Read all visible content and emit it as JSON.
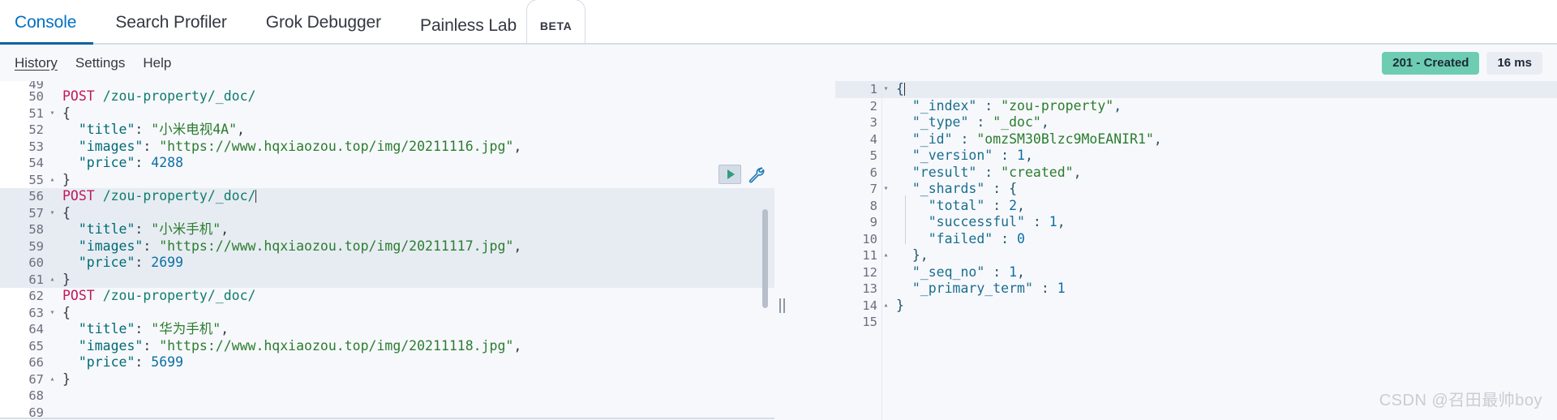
{
  "app": {
    "top_tabs": [
      {
        "label": "Console",
        "active": true,
        "badge": null
      },
      {
        "label": "Search Profiler",
        "active": false,
        "badge": null
      },
      {
        "label": "Grok Debugger",
        "active": false,
        "badge": null
      },
      {
        "label": "Painless Lab",
        "active": false,
        "badge": "BETA"
      }
    ],
    "sub_links": [
      {
        "label": "History",
        "underlined": true
      },
      {
        "label": "Settings",
        "underlined": false
      },
      {
        "label": "Help",
        "underlined": false
      }
    ],
    "status": {
      "response_code": "201 - Created",
      "response_code_color": "#6dccb1",
      "elapsed": "16 ms",
      "elapsed_color": "#e9edf3"
    },
    "accent_color": "#0071c2",
    "active_tab_underline_color": "#0b64a0",
    "watermark": "CSDN @召田最帅boy"
  },
  "request_editor": {
    "name": "console-request-editor",
    "active_line": 56,
    "lines": [
      {
        "n": "49",
        "fold": "",
        "partial": true,
        "segments": [
          {
            "t": "",
            "c": "punct"
          }
        ]
      },
      {
        "n": "50",
        "fold": "",
        "segments": [
          {
            "t": "POST",
            "c": "kw"
          },
          {
            "t": " ",
            "c": "punct"
          },
          {
            "t": "/zou-property/_doc/",
            "c": "url"
          }
        ]
      },
      {
        "n": "51",
        "fold": "▾",
        "segments": [
          {
            "t": "{",
            "c": "punct"
          }
        ]
      },
      {
        "n": "52",
        "fold": "",
        "segments": [
          {
            "t": "  ",
            "c": "punct"
          },
          {
            "t": "\"title\"",
            "c": "key"
          },
          {
            "t": ": ",
            "c": "punct"
          },
          {
            "t": "\"小米电视4A\"",
            "c": "str"
          },
          {
            "t": ",",
            "c": "punct"
          }
        ]
      },
      {
        "n": "53",
        "fold": "",
        "segments": [
          {
            "t": "  ",
            "c": "punct"
          },
          {
            "t": "\"images\"",
            "c": "key"
          },
          {
            "t": ": ",
            "c": "punct"
          },
          {
            "t": "\"https://www.hqxiaozou.top/img/20211116.jpg\"",
            "c": "str"
          },
          {
            "t": ",",
            "c": "punct"
          }
        ]
      },
      {
        "n": "54",
        "fold": "",
        "segments": [
          {
            "t": "  ",
            "c": "punct"
          },
          {
            "t": "\"price\"",
            "c": "key"
          },
          {
            "t": ": ",
            "c": "punct"
          },
          {
            "t": "4288",
            "c": "num-v"
          }
        ]
      },
      {
        "n": "55",
        "fold": "▴",
        "segments": [
          {
            "t": "}",
            "c": "punct"
          }
        ]
      },
      {
        "n": "56",
        "fold": "",
        "highlight": true,
        "cursor": true,
        "segments": [
          {
            "t": "POST",
            "c": "kw"
          },
          {
            "t": " ",
            "c": "punct"
          },
          {
            "t": "/zou-property/_doc/",
            "c": "url"
          }
        ]
      },
      {
        "n": "57",
        "fold": "▾",
        "highlight": true,
        "segments": [
          {
            "t": "{",
            "c": "punct"
          }
        ]
      },
      {
        "n": "58",
        "fold": "",
        "highlight": true,
        "segments": [
          {
            "t": "  ",
            "c": "punct"
          },
          {
            "t": "\"title\"",
            "c": "key"
          },
          {
            "t": ": ",
            "c": "punct"
          },
          {
            "t": "\"小米手机\"",
            "c": "str"
          },
          {
            "t": ",",
            "c": "punct"
          }
        ]
      },
      {
        "n": "59",
        "fold": "",
        "highlight": true,
        "segments": [
          {
            "t": "  ",
            "c": "punct"
          },
          {
            "t": "\"images\"",
            "c": "key"
          },
          {
            "t": ": ",
            "c": "punct"
          },
          {
            "t": "\"https://www.hqxiaozou.top/img/20211117.jpg\"",
            "c": "str"
          },
          {
            "t": ",",
            "c": "punct"
          }
        ]
      },
      {
        "n": "60",
        "fold": "",
        "highlight": true,
        "segments": [
          {
            "t": "  ",
            "c": "punct"
          },
          {
            "t": "\"price\"",
            "c": "key"
          },
          {
            "t": ": ",
            "c": "punct"
          },
          {
            "t": "2699",
            "c": "num-v"
          }
        ]
      },
      {
        "n": "61",
        "fold": "▴",
        "highlight": true,
        "segments": [
          {
            "t": "}",
            "c": "punct"
          }
        ]
      },
      {
        "n": "62",
        "fold": "",
        "segments": [
          {
            "t": "POST",
            "c": "kw"
          },
          {
            "t": " ",
            "c": "punct"
          },
          {
            "t": "/zou-property/_doc/",
            "c": "url"
          }
        ]
      },
      {
        "n": "63",
        "fold": "▾",
        "segments": [
          {
            "t": "{",
            "c": "punct"
          }
        ]
      },
      {
        "n": "64",
        "fold": "",
        "segments": [
          {
            "t": "  ",
            "c": "punct"
          },
          {
            "t": "\"title\"",
            "c": "key"
          },
          {
            "t": ": ",
            "c": "punct"
          },
          {
            "t": "\"华为手机\"",
            "c": "str"
          },
          {
            "t": ",",
            "c": "punct"
          }
        ]
      },
      {
        "n": "65",
        "fold": "",
        "segments": [
          {
            "t": "  ",
            "c": "punct"
          },
          {
            "t": "\"images\"",
            "c": "key"
          },
          {
            "t": ": ",
            "c": "punct"
          },
          {
            "t": "\"https://www.hqxiaozou.top/img/20211118.jpg\"",
            "c": "str"
          },
          {
            "t": ",",
            "c": "punct"
          }
        ]
      },
      {
        "n": "66",
        "fold": "",
        "segments": [
          {
            "t": "  ",
            "c": "punct"
          },
          {
            "t": "\"price\"",
            "c": "key"
          },
          {
            "t": ": ",
            "c": "punct"
          },
          {
            "t": "5699",
            "c": "num-v"
          }
        ]
      },
      {
        "n": "67",
        "fold": "▴",
        "segments": [
          {
            "t": "}",
            "c": "punct"
          }
        ]
      },
      {
        "n": "68",
        "fold": "",
        "segments": [
          {
            "t": "",
            "c": "punct"
          }
        ]
      },
      {
        "n": "69",
        "fold": "",
        "segments": [
          {
            "t": "",
            "c": "punct"
          }
        ]
      }
    ],
    "actions": {
      "play_label": "play-request",
      "wrench_label": "open-documentation"
    }
  },
  "response_editor": {
    "name": "console-response-viewer",
    "lines": [
      {
        "n": "1",
        "fold": "▾",
        "highlight": true,
        "cursor": true,
        "segments": [
          {
            "t": "{",
            "c": "rpunct"
          }
        ]
      },
      {
        "n": "2",
        "fold": "",
        "segments": [
          {
            "t": "  ",
            "c": "rpunct"
          },
          {
            "t": "\"_index\"",
            "c": "rkey"
          },
          {
            "t": " : ",
            "c": "rpunct"
          },
          {
            "t": "\"zou-property\"",
            "c": "rstr"
          },
          {
            "t": ",",
            "c": "rpunct"
          }
        ]
      },
      {
        "n": "3",
        "fold": "",
        "segments": [
          {
            "t": "  ",
            "c": "rpunct"
          },
          {
            "t": "\"_type\"",
            "c": "rkey"
          },
          {
            "t": " : ",
            "c": "rpunct"
          },
          {
            "t": "\"_doc\"",
            "c": "rstr"
          },
          {
            "t": ",",
            "c": "rpunct"
          }
        ]
      },
      {
        "n": "4",
        "fold": "",
        "segments": [
          {
            "t": "  ",
            "c": "rpunct"
          },
          {
            "t": "\"_id\"",
            "c": "rkey"
          },
          {
            "t": " : ",
            "c": "rpunct"
          },
          {
            "t": "\"omzSM30Blzc9MoEANIR1\"",
            "c": "rstr"
          },
          {
            "t": ",",
            "c": "rpunct"
          }
        ]
      },
      {
        "n": "5",
        "fold": "",
        "segments": [
          {
            "t": "  ",
            "c": "rpunct"
          },
          {
            "t": "\"_version\"",
            "c": "rkey"
          },
          {
            "t": " : ",
            "c": "rpunct"
          },
          {
            "t": "1",
            "c": "num-v"
          },
          {
            "t": ",",
            "c": "rpunct"
          }
        ]
      },
      {
        "n": "6",
        "fold": "",
        "segments": [
          {
            "t": "  ",
            "c": "rpunct"
          },
          {
            "t": "\"result\"",
            "c": "rkey"
          },
          {
            "t": " : ",
            "c": "rpunct"
          },
          {
            "t": "\"created\"",
            "c": "rstr"
          },
          {
            "t": ",",
            "c": "rpunct"
          }
        ]
      },
      {
        "n": "7",
        "fold": "▾",
        "segments": [
          {
            "t": "  ",
            "c": "rpunct"
          },
          {
            "t": "\"_shards\"",
            "c": "rkey"
          },
          {
            "t": " : ",
            "c": "rpunct"
          },
          {
            "t": "{",
            "c": "rpunct"
          }
        ]
      },
      {
        "n": "8",
        "fold": "",
        "segments": [
          {
            "t": "    ",
            "c": "rpunct"
          },
          {
            "t": "\"total\"",
            "c": "rkey"
          },
          {
            "t": " : ",
            "c": "rpunct"
          },
          {
            "t": "2",
            "c": "num-v"
          },
          {
            "t": ",",
            "c": "rpunct"
          }
        ]
      },
      {
        "n": "9",
        "fold": "",
        "segments": [
          {
            "t": "    ",
            "c": "rpunct"
          },
          {
            "t": "\"successful\"",
            "c": "rkey"
          },
          {
            "t": " : ",
            "c": "rpunct"
          },
          {
            "t": "1",
            "c": "num-v"
          },
          {
            "t": ",",
            "c": "rpunct"
          }
        ]
      },
      {
        "n": "10",
        "fold": "",
        "segments": [
          {
            "t": "    ",
            "c": "rpunct"
          },
          {
            "t": "\"failed\"",
            "c": "rkey"
          },
          {
            "t": " : ",
            "c": "rpunct"
          },
          {
            "t": "0",
            "c": "num-v"
          }
        ]
      },
      {
        "n": "11",
        "fold": "▴",
        "segments": [
          {
            "t": "  ",
            "c": "rpunct"
          },
          {
            "t": "},",
            "c": "rpunct"
          }
        ]
      },
      {
        "n": "12",
        "fold": "",
        "segments": [
          {
            "t": "  ",
            "c": "rpunct"
          },
          {
            "t": "\"_seq_no\"",
            "c": "rkey"
          },
          {
            "t": " : ",
            "c": "rpunct"
          },
          {
            "t": "1",
            "c": "num-v"
          },
          {
            "t": ",",
            "c": "rpunct"
          }
        ]
      },
      {
        "n": "13",
        "fold": "",
        "segments": [
          {
            "t": "  ",
            "c": "rpunct"
          },
          {
            "t": "\"_primary_term\"",
            "c": "rkey"
          },
          {
            "t": " : ",
            "c": "rpunct"
          },
          {
            "t": "1",
            "c": "num-v"
          }
        ]
      },
      {
        "n": "14",
        "fold": "▴",
        "segments": [
          {
            "t": "}",
            "c": "rpunct"
          }
        ]
      },
      {
        "n": "15",
        "fold": "",
        "segments": [
          {
            "t": "",
            "c": "rpunct"
          }
        ]
      }
    ]
  }
}
